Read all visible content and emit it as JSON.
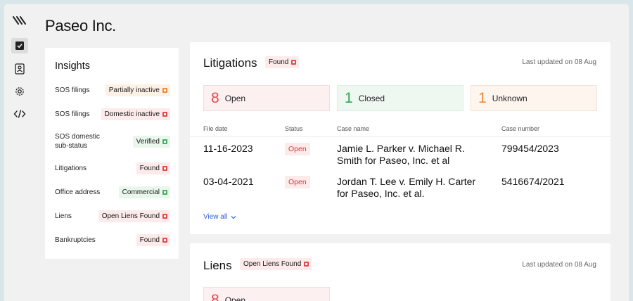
{
  "company": {
    "name": "Paseo Inc."
  },
  "sidebar": {
    "icons": [
      "logo-icon",
      "checkbox-icon",
      "id-card-icon",
      "gear-icon",
      "code-icon"
    ]
  },
  "insights": {
    "title": "Insights",
    "rows": [
      {
        "label": "SOS filings",
        "status": "Partially inactive",
        "color": "orange"
      },
      {
        "label": "SOS filings",
        "status": "Domestic inactive",
        "color": "red"
      },
      {
        "label": "SOS domestic sub-status",
        "status": "Verified",
        "color": "green"
      },
      {
        "label": "Litigations",
        "status": "Found",
        "color": "red"
      },
      {
        "label": "Office address",
        "status": "Commercial",
        "color": "green"
      },
      {
        "label": "Liens",
        "status": "Open Liens Found",
        "color": "red"
      },
      {
        "label": "Bankruptcies",
        "status": "Found",
        "color": "red"
      }
    ]
  },
  "litigations": {
    "title": "Litigations",
    "tag": "Found",
    "updated": "Last updated on 08 Aug",
    "stats": [
      {
        "num": "8",
        "label": "Open"
      },
      {
        "num": "1",
        "label": "Closed"
      },
      {
        "num": "1",
        "label": "Unknown"
      }
    ],
    "columns": [
      "File date",
      "Status",
      "Case name",
      "Case number"
    ],
    "rows": [
      {
        "date": "11-16-2023",
        "status": "Open",
        "case_name": "Jamie L. Parker v. Michael R. Smith for Paseo, Inc. et al",
        "case_number": "799454/2023"
      },
      {
        "date": "03-04-2021",
        "status": "Open",
        "case_name": "Jordan T. Lee v. Emily H. Carter for Paseo, Inc. et al.",
        "case_number": "5416674/2021"
      }
    ],
    "view_all": "View all"
  },
  "liens": {
    "title": "Liens",
    "tag": "Open Liens Found",
    "updated": "Last updated on 08 Aug",
    "stats": [
      {
        "num": "8",
        "label": "Open"
      }
    ]
  },
  "colors": {
    "red": "#e5484d",
    "green": "#3fb560",
    "orange": "#f08a3c",
    "link": "#2b5fd9"
  }
}
